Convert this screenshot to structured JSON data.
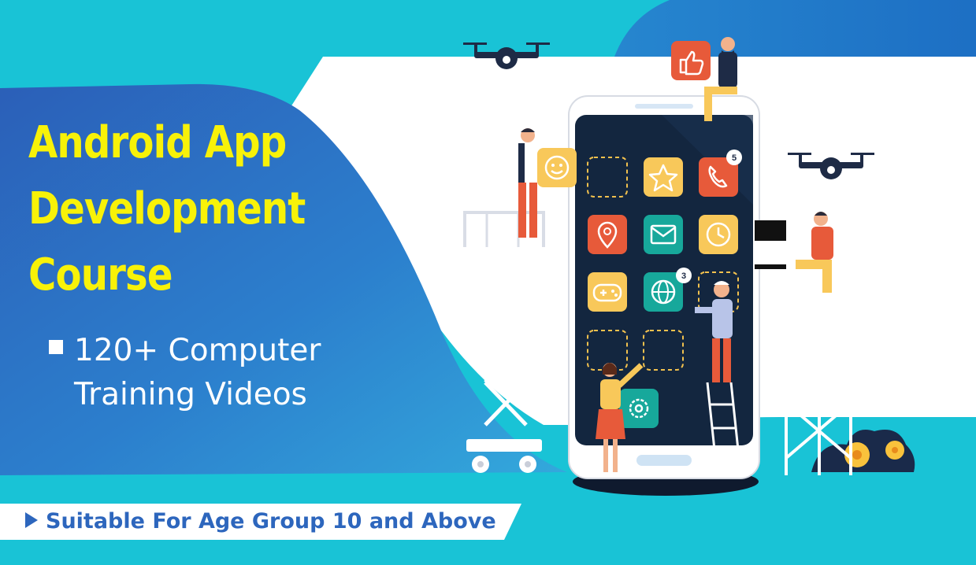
{
  "headline": {
    "line1": "Android App",
    "line2": "Development",
    "line3": "Course"
  },
  "bullet": {
    "line1": "120+ Computer",
    "line2": "Training Videos"
  },
  "banner": {
    "text": "Suitable For Age Group 10 and Above"
  },
  "phone": {
    "apps": [
      {
        "icon": "dashed-empty-slot"
      },
      {
        "icon": "star-icon"
      },
      {
        "icon": "phone-icon",
        "badge": "5"
      },
      {
        "icon": "location-pin-icon"
      },
      {
        "icon": "mail-icon"
      },
      {
        "icon": "clock-icon"
      },
      {
        "icon": "gamepad-icon"
      },
      {
        "icon": "globe-icon",
        "badge": "3"
      },
      {
        "icon": "dashed-empty-slot"
      },
      {
        "icon": "dashed-empty-slot"
      },
      {
        "icon": "dashed-empty-slot"
      },
      {
        "icon": "settings-gear-icon"
      }
    ]
  },
  "colors": {
    "background_cyan": "#19c3d6",
    "panel_blue": "#2a73c4",
    "headline_yellow": "#f8f208",
    "banner_text_blue": "#2d66bd",
    "phone_screen_navy": "#13263f",
    "tile_yellow": "#f8c85a",
    "tile_orange": "#e75a3a",
    "tile_teal": "#17a89b"
  }
}
